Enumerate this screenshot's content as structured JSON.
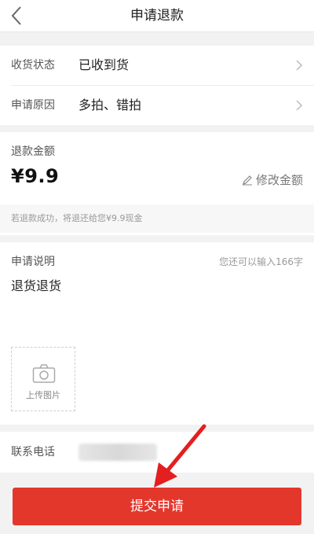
{
  "header": {
    "title": "申请退款",
    "back_icon": "back-chevron-icon"
  },
  "status_row": {
    "label": "收货状态",
    "value": "已收到货"
  },
  "reason_row": {
    "label": "申请原因",
    "value": "多拍、错拍"
  },
  "refund": {
    "label": "退款金额",
    "amount": "¥9.9",
    "edit_label": "修改金额",
    "note": "若退款成功，将退还给您¥9.9现金"
  },
  "explanation": {
    "label": "申请说明",
    "counter": "您还可以输入166字",
    "text": "退货退货",
    "upload_label": "上传图片"
  },
  "contact": {
    "label": "联系电话"
  },
  "submit": {
    "label": "提交申请",
    "color": "#e4372c"
  },
  "annotation": {
    "arrow_color": "#e41f1f"
  }
}
